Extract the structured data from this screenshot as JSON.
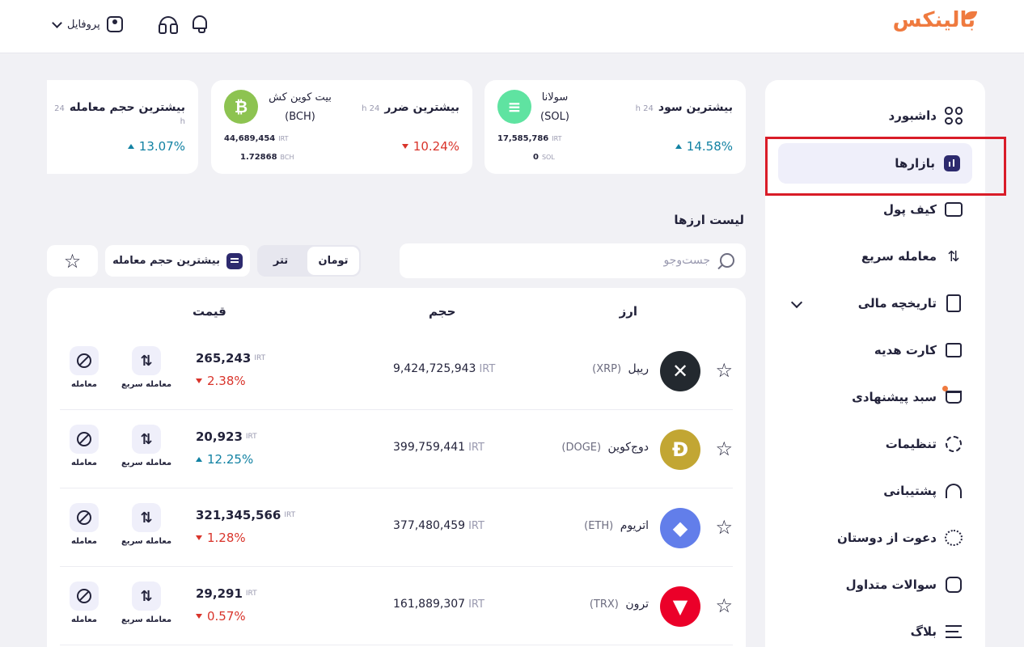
{
  "header": {
    "logo": "بالینکس",
    "profile_label": "پروفایل",
    "icons": [
      "bell-icon",
      "headset-icon",
      "profile-icon",
      "chevron-down-icon"
    ]
  },
  "sidebar": {
    "items": [
      {
        "label": "داشبورد",
        "icon": "dashboard-icon"
      },
      {
        "label": "بازارها",
        "icon": "markets-icon",
        "active": true
      },
      {
        "label": "کیف پول",
        "icon": "wallet-icon"
      },
      {
        "label": "معامله سریع",
        "icon": "swap-icon"
      },
      {
        "label": "تاریخچه مالی",
        "icon": "receipt-icon"
      },
      {
        "label": "کارت هدیه",
        "icon": "gift-icon"
      },
      {
        "label": "سبد پیشنهادی",
        "icon": "basket-icon"
      },
      {
        "label": "تنظیمات",
        "icon": "gear-icon"
      },
      {
        "label": "پشتیبانی",
        "icon": "headset-icon"
      },
      {
        "label": "دعوت از دوستان",
        "icon": "invite-icon"
      },
      {
        "label": "سوالات متداول",
        "icon": "faq-icon"
      },
      {
        "label": "بلاگ",
        "icon": "blog-icon"
      }
    ]
  },
  "stats": {
    "gain": {
      "title": "بیشترین سود",
      "period": "24 h",
      "change": "14.58%",
      "coin_name": "سولانا",
      "coin_symbol": "(SOL)",
      "price": "17,585,786",
      "price_unit": "IRT",
      "amount": "0",
      "amount_unit": "SOL",
      "color": "#5fe3a1"
    },
    "loss": {
      "title": "بیشترین ضرر",
      "period": "24 h",
      "change": "10.24%",
      "coin_name": "بیت کوین کش",
      "coin_symbol": "(BCH)",
      "price": "44,689,454",
      "price_unit": "IRT",
      "amount": "1.72868",
      "amount_unit": "BCH",
      "color": "#8dc351"
    },
    "volume": {
      "title": "بیشترین حجم معامله",
      "period": "24 h",
      "change": "13.07%"
    }
  },
  "list": {
    "title": "لیست ارزها",
    "search_placeholder": "جست‌وجو",
    "toman": "تومان",
    "tether": "تتر",
    "sort_label": "بیشترین حجم معامله",
    "columns": {
      "coin": "ارز",
      "volume": "حجم",
      "price": "قیمت"
    },
    "trade_label": "معامله",
    "fast_label": "معامله سریع",
    "unit": "IRT",
    "rows": [
      {
        "name": "ریپل",
        "symbol": "(XRP)",
        "volume": "9,424,725,943",
        "price": "265,243",
        "change": "2.38%",
        "dir": "down",
        "logo": "✕",
        "color": "#23292f"
      },
      {
        "name": "دوج‌کوین",
        "symbol": "(DOGE)",
        "volume": "399,759,441",
        "price": "20,923",
        "change": "12.25%",
        "dir": "up",
        "logo": "Ð",
        "color": "#c2a633"
      },
      {
        "name": "اتریوم",
        "symbol": "(ETH)",
        "volume": "377,480,459",
        "price": "321,345,566",
        "change": "1.28%",
        "dir": "down",
        "logo": "◆",
        "color": "#627eea"
      },
      {
        "name": "ترون",
        "symbol": "(TRX)",
        "volume": "161,889,307",
        "price": "29,291",
        "change": "0.57%",
        "dir": "down",
        "logo": "▼",
        "color": "#eb0029"
      }
    ]
  }
}
